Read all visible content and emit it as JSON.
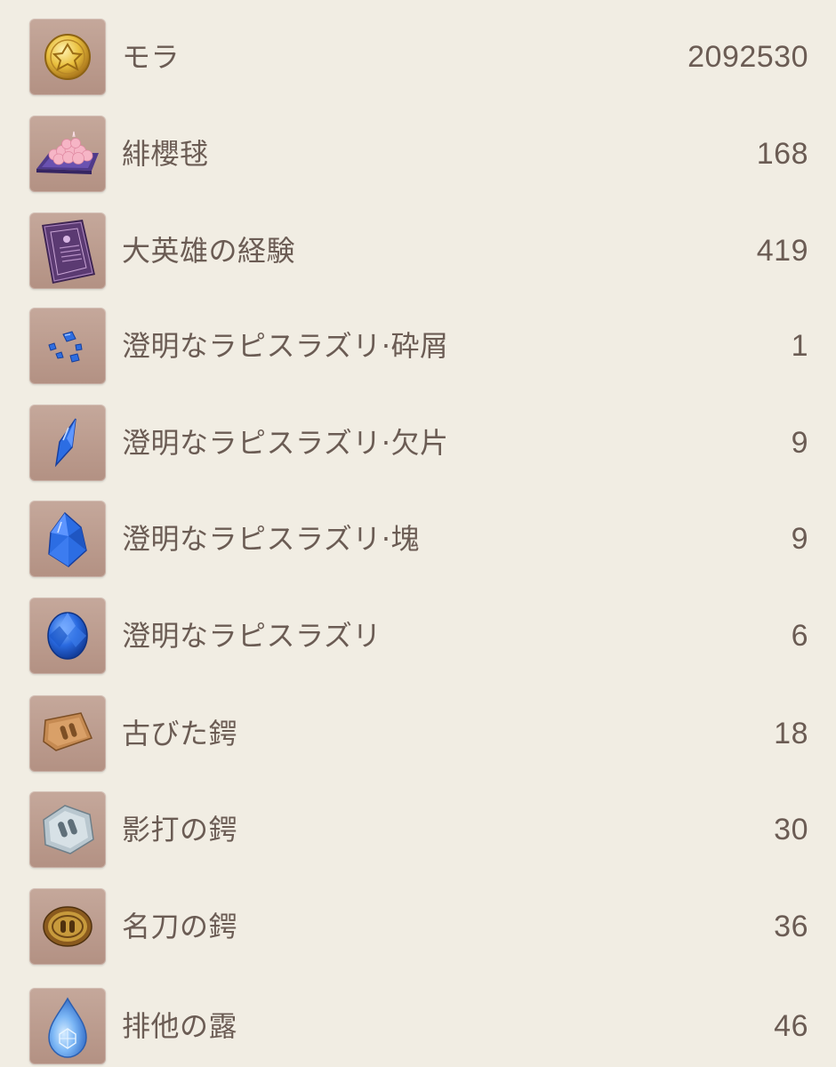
{
  "items": [
    {
      "name": "モラ",
      "count": "2092530",
      "icon": "mora-coin-icon"
    },
    {
      "name": "緋櫻毬",
      "count": "168",
      "icon": "sakura-bloom-icon"
    },
    {
      "name": "大英雄の経験",
      "count": "419",
      "icon": "heros-wit-book-icon"
    },
    {
      "name": "澄明なラピスラズリ·砕屑",
      "count": "1",
      "icon": "lapis-sliver-icon"
    },
    {
      "name": "澄明なラピスラズリ·欠片",
      "count": "9",
      "icon": "lapis-fragment-icon"
    },
    {
      "name": "澄明なラピスラズリ·塊",
      "count": "9",
      "icon": "lapis-chunk-icon"
    },
    {
      "name": "澄明なラピスラズリ",
      "count": "6",
      "icon": "lapis-gemstone-icon"
    },
    {
      "name": "古びた鍔",
      "count": "18",
      "icon": "old-handguard-icon"
    },
    {
      "name": "影打の鍔",
      "count": "30",
      "icon": "kageuchi-handguard-icon"
    },
    {
      "name": "名刀の鍔",
      "count": "36",
      "icon": "famed-handguard-icon"
    },
    {
      "name": "排他の露",
      "count": "46",
      "icon": "dew-drop-icon"
    }
  ],
  "colors": {
    "background": "#f1ede3",
    "text": "#6b5c54",
    "icon_frame": "#b99a8c"
  }
}
